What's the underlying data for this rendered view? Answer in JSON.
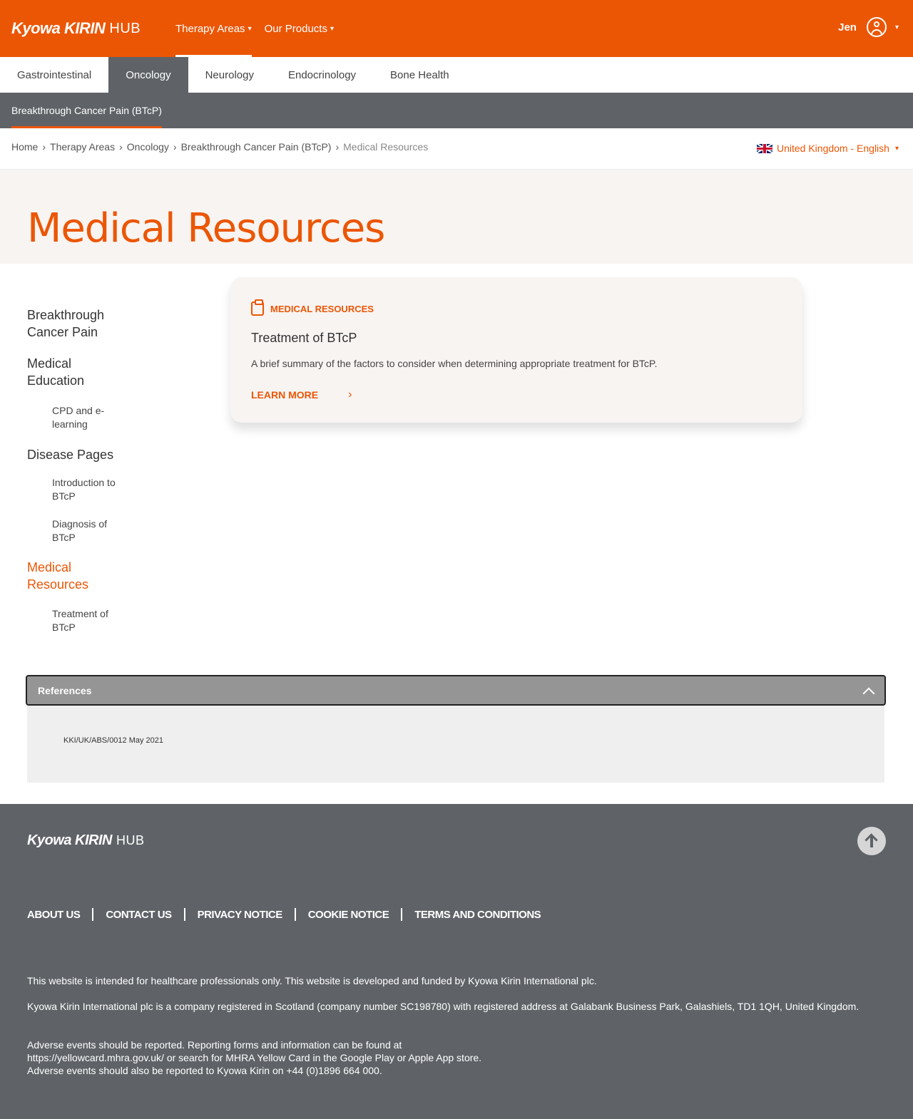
{
  "header": {
    "logo_mark": "Kyowa KIRIN",
    "logo_suffix": "HUB",
    "nav": [
      {
        "label": "Therapy Areas",
        "caret": "▾"
      },
      {
        "label": "Our Products",
        "caret": "▾"
      }
    ],
    "user_name": "Jen",
    "user_caret": "▾"
  },
  "therapy_tabs": [
    "Gastrointestinal",
    "Oncology",
    "Neurology",
    "Endocrinology",
    "Bone Health"
  ],
  "active_tab": "Oncology",
  "subnav": {
    "label": "Breakthrough Cancer Pain (BTcP)"
  },
  "breadcrumb": {
    "items": [
      "Home",
      "Therapy Areas",
      "Oncology",
      "Breakthrough Cancer Pain (BTcP)"
    ],
    "current": "Medical Resources",
    "separator": "›"
  },
  "locale": {
    "label": "United Kingdom - English",
    "caret": "▾"
  },
  "page_title": "Medical Resources",
  "sidenav": {
    "breakthrough": "Breakthrough Cancer Pain",
    "medical_education": "Medical Education",
    "cpd": "CPD and e-learning",
    "disease_pages": "Disease Pages",
    "intro": "Introduction to BTcP",
    "diagnosis": "Diagnosis of BTcP",
    "medical_resources": "Medical Resources",
    "treatment": "Treatment of BTcP"
  },
  "card": {
    "category": "MEDICAL RESOURCES",
    "title": "Treatment of BTcP",
    "description": "A brief summary of the factors to consider when determining appropriate treatment for BTcP.",
    "link_label": "LEARN MORE",
    "link_chevron": "›"
  },
  "references": {
    "title": "References",
    "code": "KKI/UK/ABS/0012  May 2021"
  },
  "footer": {
    "logo_mark": "Kyowa KIRIN",
    "logo_suffix": "HUB",
    "links": [
      "ABOUT US",
      "CONTACT US",
      "PRIVACY NOTICE",
      "COOKIE NOTICE",
      "TERMS AND CONDITIONS"
    ],
    "text1": "This website is intended for healthcare professionals only. This website is developed and funded by Kyowa Kirin International plc.",
    "text2": "Kyowa Kirin International plc is a company registered in Scotland (company number SC198780) with registered address at Galabank Business Park, Galashiels, TD1 1QH, United Kingdom.",
    "text3a": "Adverse events should be reported. Reporting forms and information can be found at",
    "text3b": "https://yellowcard.mhra.gov.uk/ or search for MHRA Yellow Card in the Google Play or Apple App store.",
    "text3c": "Adverse events should also be reported to Kyowa Kirin on +44 (0)1896 664 000."
  },
  "colors": {
    "brand_orange": "#eb5605",
    "dark_grey": "#5f6368",
    "hero_bg": "#f8f4f2",
    "references_bar": "#959595"
  },
  "icons": [
    "user-icon",
    "uk-flag-icon",
    "clipboard-icon",
    "chevron-right-icon",
    "chevron-up-icon",
    "arrow-up-icon"
  ]
}
